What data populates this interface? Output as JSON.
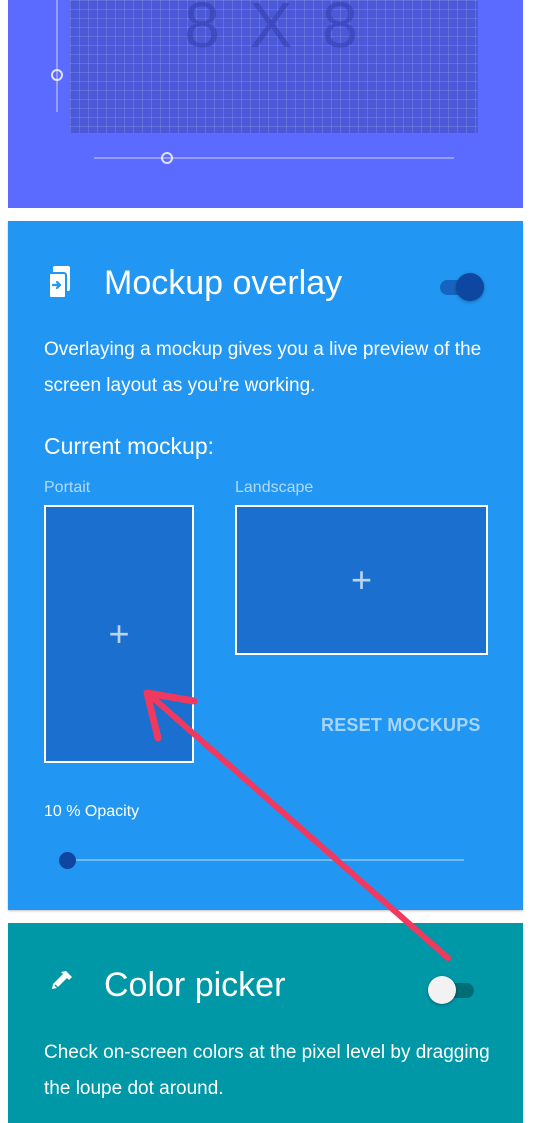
{
  "grid_card": {
    "grid_size_text": "8 X 8"
  },
  "mockup_card": {
    "title": "Mockup overlay",
    "toggle_on": true,
    "description": "Overlaying a mockup gives you a live preview of the screen layout as you’re working.",
    "current_label": "Current mockup:",
    "portrait_label": "Portait",
    "landscape_label": "Landscape",
    "add_symbol": "+",
    "reset_label": "RESET MOCKUPS",
    "opacity_label": "10 % Opacity",
    "opacity_value": 10
  },
  "color_picker_card": {
    "title": "Color picker",
    "toggle_on": false,
    "description": "Check on-screen colors at the pixel level by dragging the loupe dot around."
  },
  "icons": {
    "mockup": "phone-arrow-icon",
    "picker": "eyedropper-icon"
  },
  "colors": {
    "grid_card_bg": "#5c6bff",
    "mockup_card_bg": "#2196f3",
    "picker_card_bg": "#0097a7",
    "annotation_arrow": "#f0395f"
  }
}
